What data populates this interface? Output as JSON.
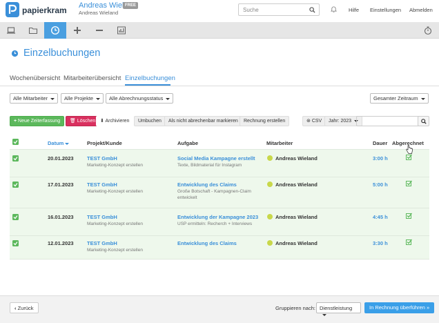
{
  "app": {
    "logo_text": "papierkram",
    "user_name": "Andreas Wieland",
    "free_badge": "FREE",
    "company_name": "Andreas Wieland"
  },
  "search": {
    "placeholder": "Suche"
  },
  "topnav": {
    "help": "Hilfe",
    "settings": "Einstellungen",
    "logout": "Abmelden"
  },
  "main_tabs": [
    {
      "icon": "laptop-icon"
    },
    {
      "icon": "folder-icon"
    },
    {
      "icon": "clock-icon",
      "active": true
    },
    {
      "icon": "plus-icon"
    },
    {
      "icon": "minus-icon"
    },
    {
      "icon": "chart-icon"
    },
    {
      "icon": "stopwatch-icon"
    }
  ],
  "page": {
    "title": "Einzelbuchungen"
  },
  "subtabs": {
    "weekly": "Wochenübersicht",
    "employees": "Mitarbeiterübersicht",
    "single": "Einzelbuchungen"
  },
  "filters": {
    "employee": "Alle Mitarbeiter",
    "project": "Alle Projekte",
    "billing": "Alle Abrechnungsstatus",
    "period": "Gesamter Zeitraum"
  },
  "actions": {
    "new": "Neue Zeiterfassung",
    "delete": "Löschen",
    "archive": "Archivieren",
    "rebook": "Umbuchen",
    "non_billable": "Als nicht abrechenbar markieren",
    "create_invoice": "Rechnung erstellen",
    "csv": "CSV",
    "year": "Jahr: 2023"
  },
  "table": {
    "headers": {
      "date": "Datum",
      "project": "Projekt/Kunde",
      "task": "Aufgabe",
      "employee": "Mitarbeiter",
      "duration": "Dauer",
      "billed": "Abgerechnet"
    },
    "rows": [
      {
        "date": "20.01.2023",
        "client": "TEST GmbH",
        "project": "Marketing-Konzept erstellen",
        "task": "Social Media Kampagne erstellt",
        "task_desc": "Texte, Bildmaterial für Instagram",
        "task_desc2": "",
        "employee": "Andreas Wieland",
        "duration": "3:00 h"
      },
      {
        "date": "17.01.2023",
        "client": "TEST GmbH",
        "project": "Marketing-Konzept erstellen",
        "task": "Entwicklung des Claims",
        "task_desc": "Große Botschaft - Kampagnen-Claim",
        "task_desc2": "entwickelt",
        "employee": "Andreas Wieland",
        "duration": "5:00 h"
      },
      {
        "date": "16.01.2023",
        "client": "TEST GmbH",
        "project": "Marketing-Konzept erstellen",
        "task": "Entwicklung der Kampagne 2023",
        "task_desc": "USP ermitteln: Recherch + Interviews",
        "task_desc2": "",
        "employee": "Andreas Wieland",
        "duration": "4:45 h"
      },
      {
        "date": "12.01.2023",
        "client": "TEST GmbH",
        "project": "Marketing-Konzept erstellen",
        "task": "Entwicklung des Claims",
        "task_desc": "",
        "task_desc2": "",
        "employee": "Andreas Wieland",
        "duration": "3:30 h"
      }
    ]
  },
  "footer": {
    "back": "Zurück",
    "group_label": "Gruppieren nach:",
    "group_value": "Dienstleistung",
    "transfer": "In Rechnung überführen »"
  },
  "colors": {
    "accent": "#3a8fd9",
    "green": "#5cb85c",
    "red": "#d9305f",
    "row_bg": "#eef8ec"
  }
}
